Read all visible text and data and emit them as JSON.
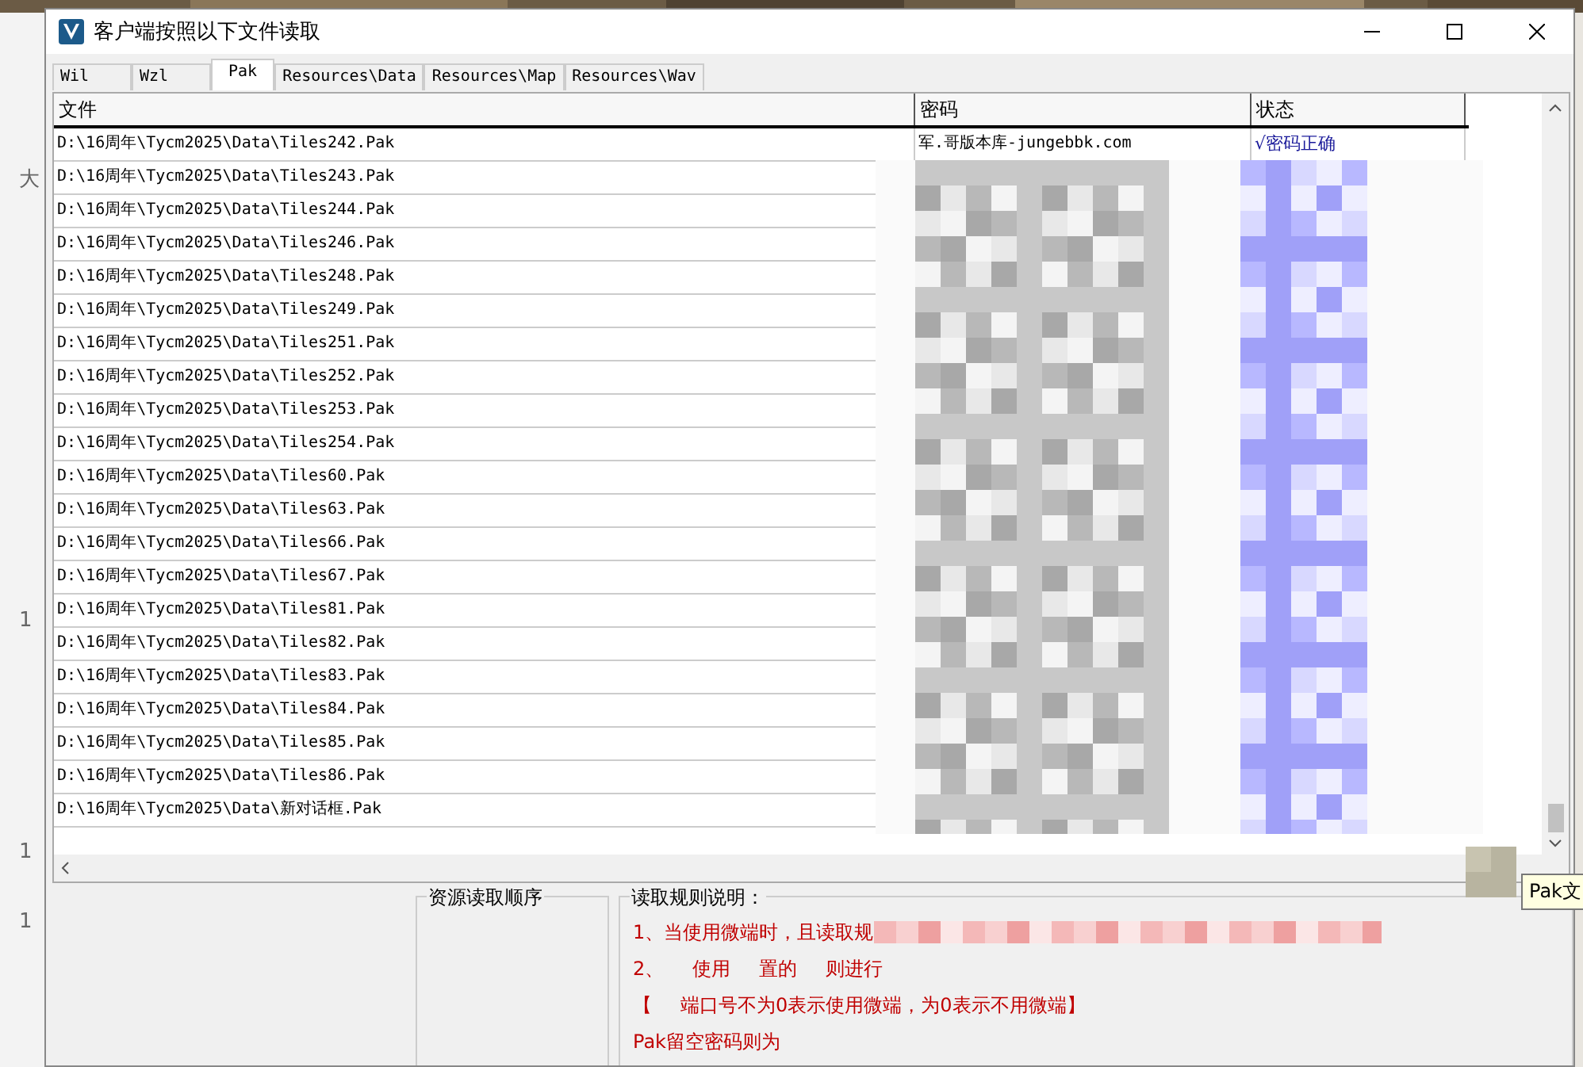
{
  "window": {
    "title": "客户端按照以下文件读取"
  },
  "tabs": [
    {
      "label": "Wil",
      "selected": false
    },
    {
      "label": "Wzl",
      "selected": false
    },
    {
      "label": "Pak",
      "selected": true
    },
    {
      "label": "Resources\\Data",
      "selected": false
    },
    {
      "label": "Resources\\Map",
      "selected": false
    },
    {
      "label": "Resources\\Wav",
      "selected": false
    }
  ],
  "table": {
    "columns": [
      "文件",
      "密码",
      "状态"
    ],
    "rows": [
      {
        "file": "D:\\16周年\\Tycm2025\\Data\\Tiles242.Pak",
        "password": "军.哥版本库-jungebbk.com",
        "status": "√密码正确"
      },
      {
        "file": "D:\\16周年\\Tycm2025\\Data\\Tiles243.Pak"
      },
      {
        "file": "D:\\16周年\\Tycm2025\\Data\\Tiles244.Pak"
      },
      {
        "file": "D:\\16周年\\Tycm2025\\Data\\Tiles246.Pak"
      },
      {
        "file": "D:\\16周年\\Tycm2025\\Data\\Tiles248.Pak"
      },
      {
        "file": "D:\\16周年\\Tycm2025\\Data\\Tiles249.Pak"
      },
      {
        "file": "D:\\16周年\\Tycm2025\\Data\\Tiles251.Pak"
      },
      {
        "file": "D:\\16周年\\Tycm2025\\Data\\Tiles252.Pak"
      },
      {
        "file": "D:\\16周年\\Tycm2025\\Data\\Tiles253.Pak"
      },
      {
        "file": "D:\\16周年\\Tycm2025\\Data\\Tiles254.Pak"
      },
      {
        "file": "D:\\16周年\\Tycm2025\\Data\\Tiles60.Pak"
      },
      {
        "file": "D:\\16周年\\Tycm2025\\Data\\Tiles63.Pak"
      },
      {
        "file": "D:\\16周年\\Tycm2025\\Data\\Tiles66.Pak"
      },
      {
        "file": "D:\\16周年\\Tycm2025\\Data\\Tiles67.Pak"
      },
      {
        "file": "D:\\16周年\\Tycm2025\\Data\\Tiles81.Pak"
      },
      {
        "file": "D:\\16周年\\Tycm2025\\Data\\Tiles82.Pak"
      },
      {
        "file": "D:\\16周年\\Tycm2025\\Data\\Tiles83.Pak"
      },
      {
        "file": "D:\\16周年\\Tycm2025\\Data\\Tiles84.Pak"
      },
      {
        "file": "D:\\16周年\\Tycm2025\\Data\\Tiles85.Pak"
      },
      {
        "file": "D:\\16周年\\Tycm2025\\Data\\Tiles86.Pak"
      },
      {
        "file": "D:\\16周年\\Tycm2025\\Data\\新对话框.Pak"
      }
    ]
  },
  "order_group": {
    "title": "资源读取顺序"
  },
  "rules_group": {
    "title": "读取规则说明：",
    "lines": [
      [
        "1、当使用微端时，且读取规"
      ],
      [
        "2、",
        "使用",
        "置的",
        "则进行"
      ],
      [
        "【",
        "端口号不为0表示使用微端，为0表示不用微端】"
      ],
      [
        "Pak留空密码则为"
      ]
    ]
  },
  "tooltip": {
    "text": "Pak文"
  },
  "background": {
    "fragments": [
      "大",
      "1",
      "1",
      "1"
    ]
  }
}
